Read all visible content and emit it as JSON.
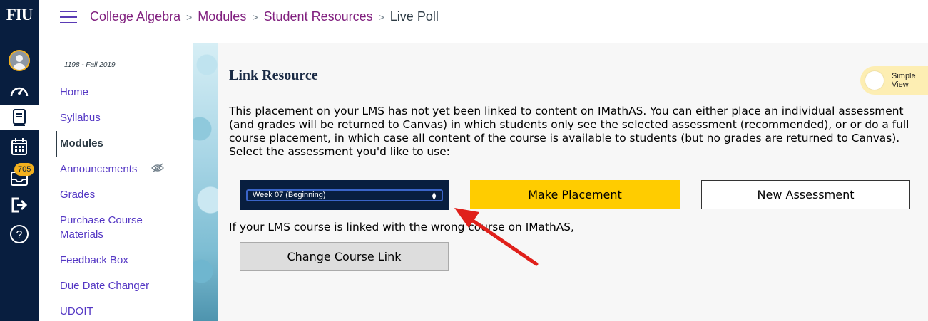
{
  "global_nav": {
    "logo": "FIU",
    "badge_count": "705",
    "icons": [
      "account-icon",
      "dashboard-icon",
      "courses-icon",
      "calendar-icon",
      "inbox-icon",
      "logout-icon",
      "help-icon"
    ]
  },
  "breadcrumb": {
    "items": [
      "College Algebra",
      "Modules",
      "Student Resources"
    ],
    "current": "Live Poll",
    "separator": ">"
  },
  "course_nav": {
    "term": "1198 - Fall 2019",
    "items": [
      {
        "label": "Home"
      },
      {
        "label": "Syllabus"
      },
      {
        "label": "Modules"
      },
      {
        "label": "Announcements"
      },
      {
        "label": "Grades"
      },
      {
        "label": "Purchase Course Materials"
      },
      {
        "label": "Feedback Box"
      },
      {
        "label": "Due Date Changer"
      },
      {
        "label": "UDOIT"
      }
    ]
  },
  "main": {
    "heading": "Link Resource",
    "simple_view": "Simple View",
    "description": "This placement on your LMS has not yet been linked to content on IMathAS. You can either place an individual assessment (and grades will be returned to Canvas) in which students only see the selected assessment (recommended), or or do a full course placement, in which case all content of the course is available to students (but no grades are returned to Canvas).",
    "select_prompt": "Select the assessment you'd like to use:",
    "selected_assessment": "Week 07 (Beginning)",
    "make_placement_label": "Make Placement",
    "new_assessment_label": "New Assessment",
    "wrong_course_text": "If your LMS course is linked with the wrong course on IMathAS,",
    "change_course_label": "Change Course Link"
  },
  "colors": {
    "nav_bg": "#081e3f",
    "accent_gold": "#ffcc00",
    "link_purple": "#5437c4",
    "breadcrumb_purple": "#81207f",
    "annotation_red": "#e0201b"
  }
}
